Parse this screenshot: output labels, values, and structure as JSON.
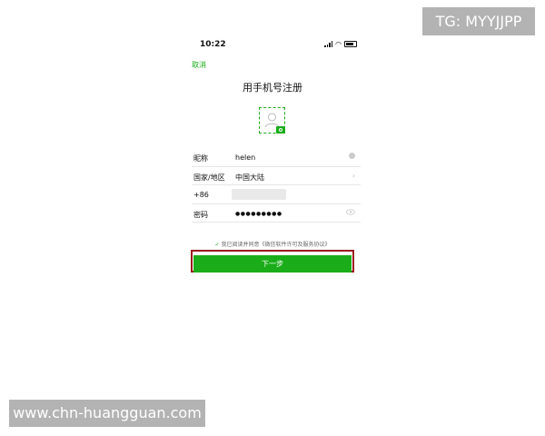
{
  "status_bar": {
    "time": "10:22"
  },
  "header": {
    "cancel_label": "取消",
    "title": "用手机号注册"
  },
  "form": {
    "nickname": {
      "label": "昵称",
      "value": "helen"
    },
    "region": {
      "label": "国家/地区",
      "value": "中国大陆"
    },
    "phone": {
      "label": "+86"
    },
    "password": {
      "label": "密码",
      "value": "●●●●●●●●●"
    }
  },
  "agreement": {
    "check_glyph": "✓",
    "text": "我已阅读并同意《微信软件许可及服务协议》"
  },
  "actions": {
    "next_label": "下一步"
  },
  "watermarks": {
    "top": "TG: MYYJJPP",
    "bottom": "www.chn-huangguan.com"
  },
  "colors": {
    "accent": "#1aad19",
    "highlight_border": "#9b1b1b",
    "watermark_bg": "#b3b3b3"
  }
}
